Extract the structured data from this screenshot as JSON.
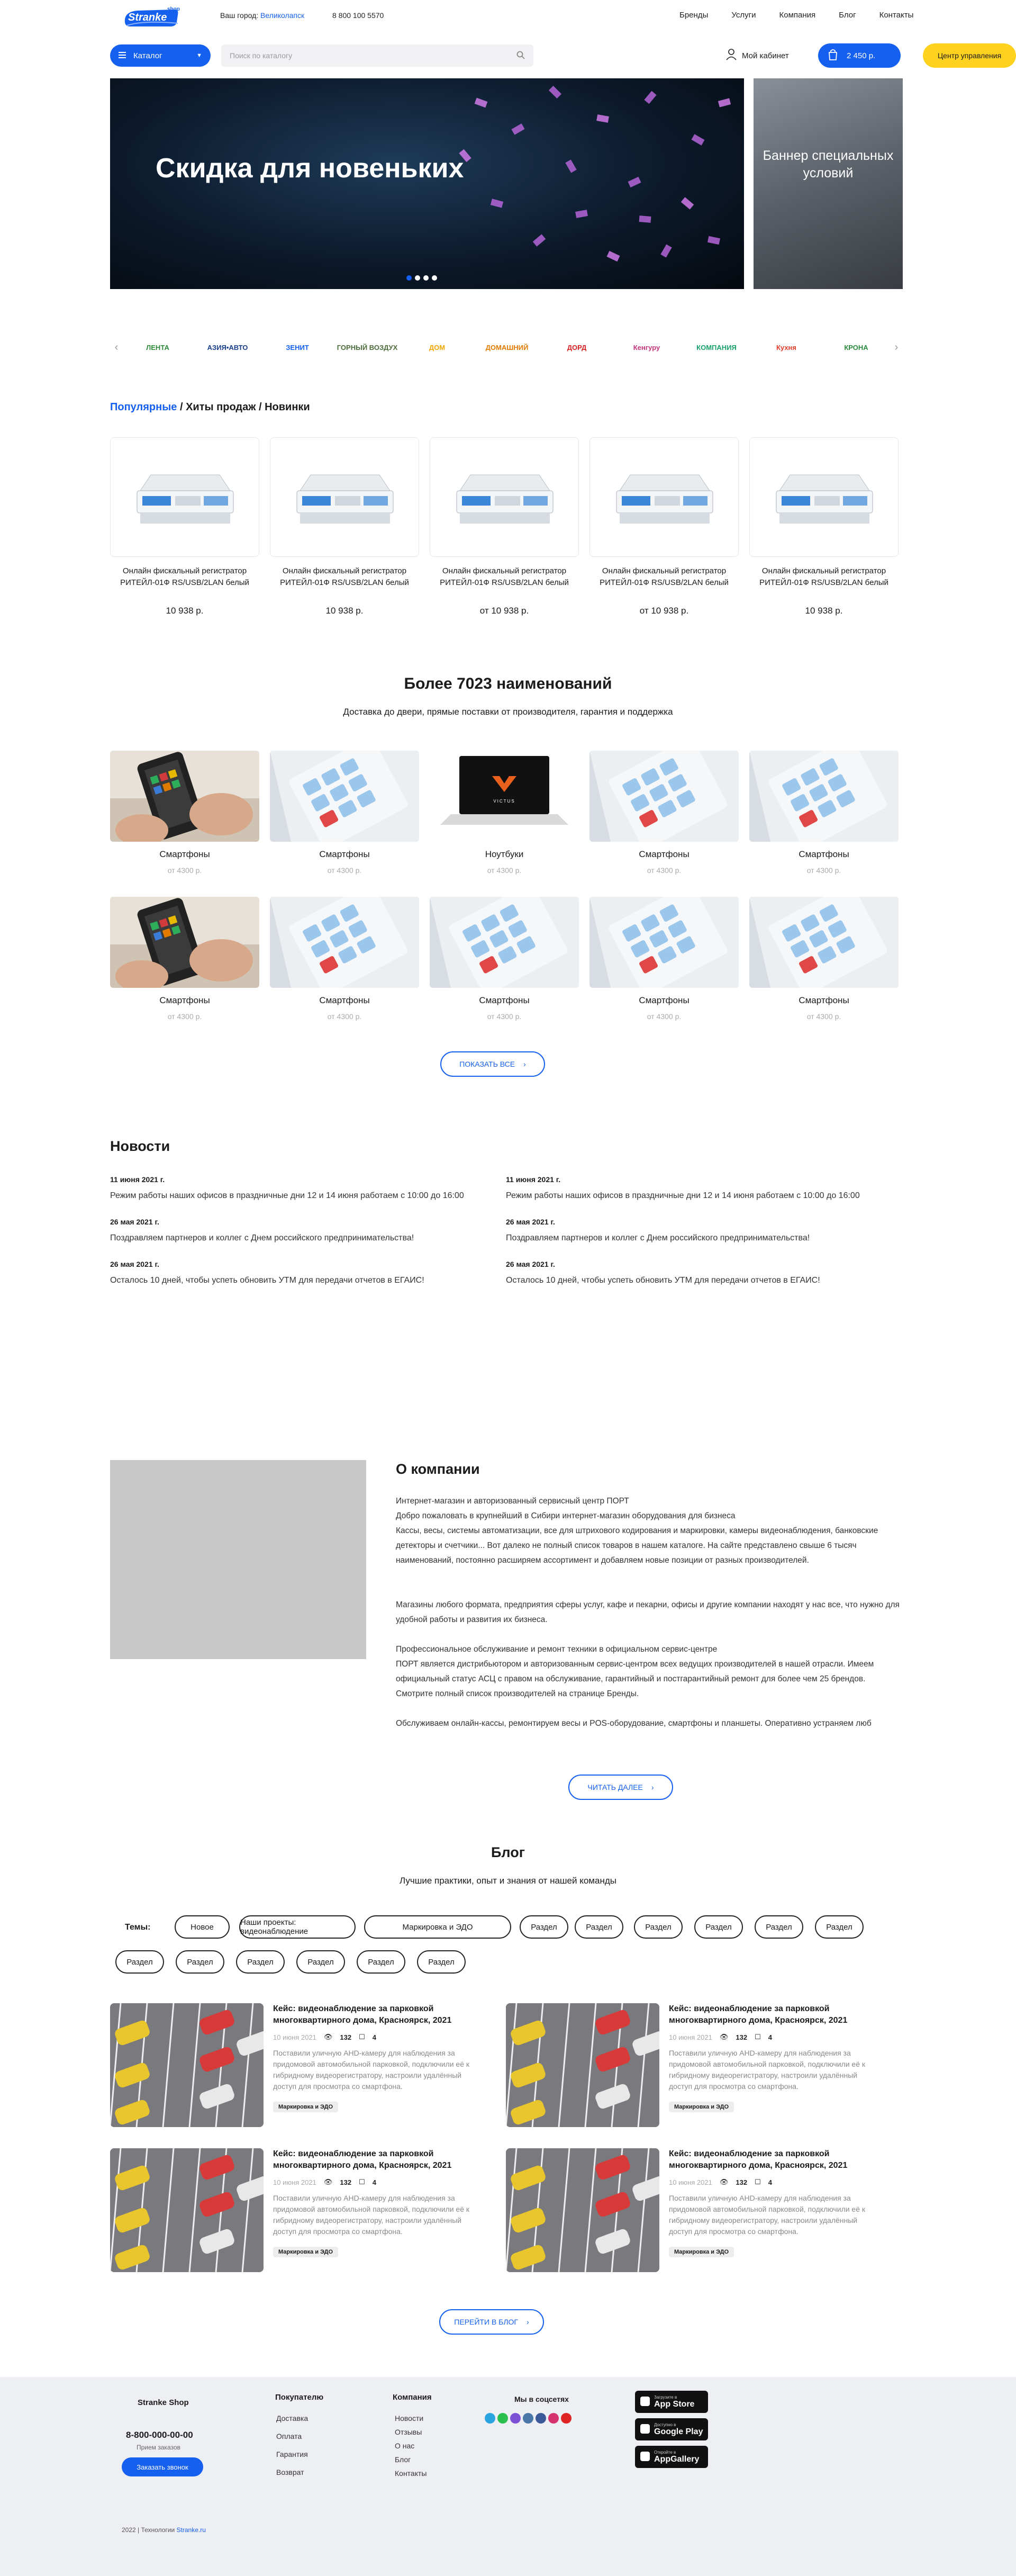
{
  "header": {
    "logo_text": "Stranke",
    "logo_sub": "shop",
    "city_label": "Ваш город:",
    "city_value": "Великолапск",
    "phone": "8 800 100 5570",
    "nav": [
      "Бренды",
      "Услуги",
      "Компания",
      "Блог",
      "Контакты"
    ],
    "catalog_label": "Каталог",
    "search_placeholder": "Поиск по каталогу",
    "cabinet_label": "Мой кабинет",
    "cart_label": "2 450 р.",
    "control_label": "Центр управления"
  },
  "hero": {
    "title": "Скидка для новеньких",
    "side_banner": "Баннер специальных условий",
    "slides_total": 4,
    "active_slide": 1
  },
  "brands": [
    {
      "name": "ЛЕНТА",
      "color": "#2e8b3a"
    },
    {
      "name": "АЗИЯ•АВТО",
      "color": "#1a3f8c"
    },
    {
      "name": "ЗЕНИТ",
      "color": "#1560ee"
    },
    {
      "name": "ГОРНЫЙ ВОЗДУХ",
      "color": "#4b6b3a"
    },
    {
      "name": "ДОМ",
      "color": "#f2a400"
    },
    {
      "name": "ДОМАШНИЙ",
      "color": "#e07a00"
    },
    {
      "name": "ДОРД",
      "color": "#d61f1f"
    },
    {
      "name": "Кенгуру",
      "color": "#c2357b"
    },
    {
      "name": "КОМПАНИЯ",
      "color": "#1aa06b"
    },
    {
      "name": "Кухня",
      "color": "#e23c2a"
    },
    {
      "name": "КРОНА",
      "color": "#2a8a3e"
    }
  ],
  "tabs": {
    "active": "Популярные",
    "sep1": " / ",
    "second": "Хиты продаж",
    "sep2": " / ",
    "third": "Новинки"
  },
  "products": [
    {
      "name": "Онлайн фискальный регистратор РИТЕЙЛ-01Ф RS/USB/2LAN белый",
      "price": "10 938 р."
    },
    {
      "name": "Онлайн фискальный регистратор РИТЕЙЛ-01Ф RS/USB/2LAN белый",
      "price": "10 938 р."
    },
    {
      "name": "Онлайн фискальный регистратор РИТЕЙЛ-01Ф RS/USB/2LAN белый",
      "price": "от 10 938 р."
    },
    {
      "name": "Онлайн фискальный регистратор РИТЕЙЛ-01Ф RS/USB/2LAN белый",
      "price": "от 10 938 р."
    },
    {
      "name": "Онлайн фискальный регистратор РИТЕЙЛ-01Ф RS/USB/2LAN белый",
      "price": "10 938 р."
    }
  ],
  "assortment": {
    "title": "Более 7023 наименований",
    "subtitle": "Доставка до двери, прямые поставки от производителя, гарантия и поддержка",
    "categories": [
      {
        "name": "Смартфоны",
        "price": "от 4300 р.",
        "img": "phone"
      },
      {
        "name": "Смартфоны",
        "price": "от 4300 р.",
        "img": "calc"
      },
      {
        "name": "Ноутбуки",
        "price": "от 4300 р.",
        "img": "laptop"
      },
      {
        "name": "Смартфоны",
        "price": "от 4300 р.",
        "img": "calc"
      },
      {
        "name": "Смартфоны",
        "price": "от 4300 р.",
        "img": "calc"
      },
      {
        "name": "Смартфоны",
        "price": "от 4300 р.",
        "img": "phone"
      },
      {
        "name": "Смартфоны",
        "price": "от 4300 р.",
        "img": "calc"
      },
      {
        "name": "Смартфоны",
        "price": "от 4300 р.",
        "img": "calc"
      },
      {
        "name": "Смартфоны",
        "price": "от 4300 р.",
        "img": "calc"
      },
      {
        "name": "Смартфоны",
        "price": "от 4300 р.",
        "img": "calc"
      }
    ],
    "laptop_brand": "VICTUS",
    "show_all": "ПОКАЗАТЬ ВСЕ"
  },
  "news": {
    "title": "Новости",
    "items": [
      {
        "date": "11 июня 2021 г.",
        "text": "Режим работы наших офисов в праздничные дни 12 и 14 июня работаем с 10:00 до 16:00"
      },
      {
        "date": "26 мая 2021 г.",
        "text": "Поздравляем партнеров и коллег с Днем российского предпринимательства!"
      },
      {
        "date": "26 мая 2021 г.",
        "text": "Осталось 10 дней, чтобы успеть обновить УТМ для передачи отчетов в ЕГАИС!"
      },
      {
        "date": "11 июня 2021 г.",
        "text": "Режим работы наших офисов в праздничные дни 12 и 14 июня работаем с 10:00 до 16:00"
      },
      {
        "date": "26 мая 2021 г.",
        "text": "Поздравляем партнеров и коллег с Днем российского предпринимательства!"
      },
      {
        "date": "26 мая 2021 г.",
        "text": "Осталось 10 дней, чтобы успеть обновить УТМ для передачи отчетов в ЕГАИС!"
      }
    ]
  },
  "about": {
    "title": "О компании",
    "p1": "Интернет-магазин и авторизованный сервисный центр ПОРТ\nДобро пожаловать в крупнейший в Сибири интернет-магазин оборудования для бизнеса\nКассы, весы, системы автоматизации, все для штрихового кодирования и маркировки, камеры видеонаблюдения, банковские детекторы и счетчики... Вот далеко не полный список товаров в нашем каталоге. На сайте представлено свыше 6 тысяч наименований, постоянно расширяем ассортимент и добавляем новые позиции от разных производителей.",
    "p2": "Магазины любого формата, предприятия сферы услуг, кафе и пекарни, офисы и другие компании находят у нас все, что нужно для удобной работы и развития их бизнеса.",
    "p3": "Профессиональное обслуживание и ремонт техники в официальном сервис-центре\nПОРТ является дистрибьютором и авторизованным сервис-центром всех ведущих производителей в нашей отрасли. Имеем официальный статус АСЦ с правом на обслуживание, гарантийный и постгарантийный ремонт для более чем 25 брендов. Смотрите полный список производителей на странице Бренды.",
    "p4": "Обслуживаем онлайн-кассы, ремонтируем весы и POS-оборудование, смартфоны и планшеты. Оперативно устраняем люб",
    "read_more": "ЧИТАТЬ ДАЛЕЕ"
  },
  "blog": {
    "title": "Блог",
    "subtitle": "Лучшие практики, опыт и знания от нашей команды",
    "themes_label": "Темы:",
    "tags_row1": [
      "Новое",
      "Наши проекты: видеонаблюдение",
      "Маркировка и ЭДО",
      "Раздел",
      "Раздел",
      "Раздел",
      "Раздел",
      "Раздел",
      "Раздел"
    ],
    "tags_row2": [
      "Раздел",
      "Раздел",
      "Раздел",
      "Раздел",
      "Раздел",
      "Раздел"
    ],
    "posts": [
      {
        "title": "Кейс: видеонаблюдение за парковкой многоквартирного дома, Красноярск, 2021",
        "date": "10 июня 2021",
        "views": "132",
        "comments": "4",
        "text": "Поставили уличную AHD-камеру для наблюдения за придомовой автомобильной парковкой, подключили её к гибридному видеорегистратору, настроили удалённый доступ для просмотра со смартфона.",
        "tag": "Маркировка и ЭДО"
      },
      {
        "title": "Кейс: видеонаблюдение за парковкой многоквартирного дома, Красноярск, 2021",
        "date": "10 июня 2021",
        "views": "132",
        "comments": "4",
        "text": "Поставили уличную AHD-камеру для наблюдения за придомовой автомобильной парковкой, подключили её к гибридному видеорегистратору, настроили удалённый доступ для просмотра со смартфона.",
        "tag": "Маркировка и ЭДО"
      },
      {
        "title": "Кейс: видеонаблюдение за парковкой многоквартирного дома, Красноярск, 2021",
        "date": "10 июня 2021",
        "views": "132",
        "comments": "4",
        "text": "Поставили уличную AHD-камеру для наблюдения за придомовой автомобильной парковкой, подключили её к гибридному видеорегистратору, настроили удалённый доступ для просмотра со смартфона.",
        "tag": "Маркировка и ЭДО"
      },
      {
        "title": "Кейс: видеонаблюдение за парковкой многоквартирного дома, Красноярск, 2021",
        "date": "10 июня 2021",
        "views": "132",
        "comments": "4",
        "text": "Поставили уличную AHD-камеру для наблюдения за придомовой автомобильной парковкой, подключили её к гибридному видеорегистратору, настроили удалённый доступ для просмотра со смартфона.",
        "tag": "Маркировка и ЭДО"
      }
    ],
    "go_blog": "ПЕРЕЙТИ В БЛОГ"
  },
  "footer": {
    "brand": "Stranke Shop",
    "phone": "8-800-000-00-00",
    "phone_note": "Прием заказов",
    "order_call": "Заказать звонок",
    "buyer_title": "Покупателю",
    "buyer_links": [
      "Доставка",
      "Оплата",
      "Гарантия",
      "Возврат"
    ],
    "company_title": "Компания",
    "company_links": [
      "Новости",
      "Отзывы",
      "О нас",
      "Блог",
      "Контакты"
    ],
    "social_title": "Мы в соцсетях",
    "social": [
      {
        "name": "telegram-icon",
        "color": "#2aa3e0"
      },
      {
        "name": "whatsapp-icon",
        "color": "#2bbf4e"
      },
      {
        "name": "viber-icon",
        "color": "#7d51d6"
      },
      {
        "name": "vk-icon",
        "color": "#4a76a8"
      },
      {
        "name": "facebook-icon",
        "color": "#3b5998"
      },
      {
        "name": "instagram-icon",
        "color": "#d6336c"
      },
      {
        "name": "youtube-icon",
        "color": "#e02424"
      }
    ],
    "stores": [
      {
        "small": "Загрузите в",
        "name": "App Store"
      },
      {
        "small": "Доступно в",
        "name": "Google Play"
      },
      {
        "small": "Откройте в",
        "name": "AppGallery"
      }
    ],
    "copyright_prefix": "2022 | Технологии ",
    "copyright_link": "Stranke.ru"
  },
  "colors": {
    "accent": "#1560ee",
    "yellow": "#ffd21f"
  }
}
